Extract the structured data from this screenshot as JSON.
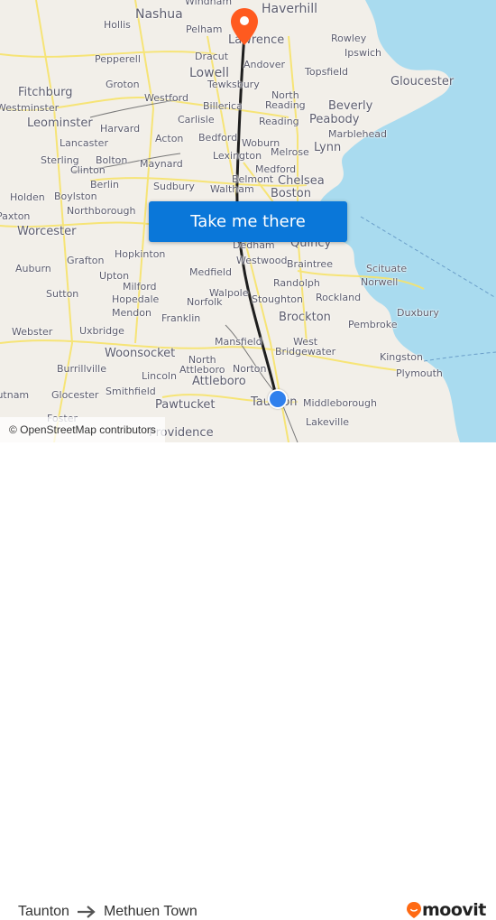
{
  "map": {
    "attribution": "© OpenStreetMap contributors",
    "colors": {
      "land": "#f2efe9",
      "water": "#a9dbef",
      "roads": "#f7e36a",
      "route_line": "#1e1e1e",
      "destination_pin": "#ff5a1f",
      "origin_dot": "#2f80ed"
    },
    "places": [
      {
        "name": "Windham",
        "size": "s"
      },
      {
        "name": "Haverhill",
        "size": "l"
      },
      {
        "name": "Nashua",
        "size": "l"
      },
      {
        "name": "Hollis",
        "size": "s"
      },
      {
        "name": "Pelham",
        "size": "s"
      },
      {
        "name": "Lawrence",
        "size": "m"
      },
      {
        "name": "Rowley",
        "size": "s"
      },
      {
        "name": "Ipswich",
        "size": "s"
      },
      {
        "name": "Pepperell",
        "size": "s"
      },
      {
        "name": "Dracut",
        "size": "s"
      },
      {
        "name": "Andover",
        "size": "s"
      },
      {
        "name": "Topsfield",
        "size": "s"
      },
      {
        "name": "Lowell",
        "size": "l"
      },
      {
        "name": "Tewksbury",
        "size": "s"
      },
      {
        "name": "Gloucester",
        "size": "m"
      },
      {
        "name": "Fitchburg",
        "size": "m"
      },
      {
        "name": "Groton",
        "size": "s"
      },
      {
        "name": "Westminster",
        "size": "s"
      },
      {
        "name": "Westford",
        "size": "s"
      },
      {
        "name": "North Reading",
        "size": "s"
      },
      {
        "name": "Beverly",
        "size": "m"
      },
      {
        "name": "Billerica",
        "size": "s"
      },
      {
        "name": "Leominster",
        "size": "m"
      },
      {
        "name": "Reading",
        "size": "s"
      },
      {
        "name": "Peabody",
        "size": "m"
      },
      {
        "name": "Harvard",
        "size": "s"
      },
      {
        "name": "Carlisle",
        "size": "s"
      },
      {
        "name": "Marblehead",
        "size": "s"
      },
      {
        "name": "Lancaster",
        "size": "s"
      },
      {
        "name": "Acton",
        "size": "s"
      },
      {
        "name": "Bedford",
        "size": "s"
      },
      {
        "name": "Woburn",
        "size": "s"
      },
      {
        "name": "Lynn",
        "size": "m"
      },
      {
        "name": "Melrose",
        "size": "s"
      },
      {
        "name": "Sterling",
        "size": "s"
      },
      {
        "name": "Bolton",
        "size": "s"
      },
      {
        "name": "Lexington",
        "size": "s"
      },
      {
        "name": "Clinton",
        "size": "s"
      },
      {
        "name": "Maynard",
        "size": "s"
      },
      {
        "name": "Medford",
        "size": "s"
      },
      {
        "name": "Berlin",
        "size": "s"
      },
      {
        "name": "Belmont",
        "size": "s"
      },
      {
        "name": "Chelsea",
        "size": "m"
      },
      {
        "name": "Sudbury",
        "size": "s"
      },
      {
        "name": "Waltham",
        "size": "s"
      },
      {
        "name": "Holden",
        "size": "s"
      },
      {
        "name": "Boylston",
        "size": "s"
      },
      {
        "name": "Boston",
        "size": "m"
      },
      {
        "name": "Northborough",
        "size": "s"
      },
      {
        "name": "Paxton",
        "size": "s"
      },
      {
        "name": "Worcester",
        "size": "m"
      },
      {
        "name": "Dedham",
        "size": "s"
      },
      {
        "name": "Quincy",
        "size": "m"
      },
      {
        "name": "Hopkinton",
        "size": "s"
      },
      {
        "name": "Westwood",
        "size": "s"
      },
      {
        "name": "Braintree",
        "size": "s"
      },
      {
        "name": "Grafton",
        "size": "s"
      },
      {
        "name": "Auburn",
        "size": "s"
      },
      {
        "name": "Medfield",
        "size": "s"
      },
      {
        "name": "Scituate",
        "size": "s"
      },
      {
        "name": "Upton",
        "size": "s"
      },
      {
        "name": "Randolph",
        "size": "s"
      },
      {
        "name": "Norwell",
        "size": "s"
      },
      {
        "name": "Milford",
        "size": "s"
      },
      {
        "name": "Walpole",
        "size": "s"
      },
      {
        "name": "Sutton",
        "size": "s"
      },
      {
        "name": "Hopedale",
        "size": "s"
      },
      {
        "name": "Norfolk",
        "size": "s"
      },
      {
        "name": "Stoughton",
        "size": "s"
      },
      {
        "name": "Rockland",
        "size": "s"
      },
      {
        "name": "Mendon",
        "size": "s"
      },
      {
        "name": "Franklin",
        "size": "s"
      },
      {
        "name": "Brockton",
        "size": "m"
      },
      {
        "name": "Pembroke",
        "size": "s"
      },
      {
        "name": "Webster",
        "size": "s"
      },
      {
        "name": "Uxbridge",
        "size": "s"
      },
      {
        "name": "Duxbury",
        "size": "s"
      },
      {
        "name": "Mansfield",
        "size": "s"
      },
      {
        "name": "West Bridgewater",
        "size": "s"
      },
      {
        "name": "Woonsocket",
        "size": "m"
      },
      {
        "name": "North Attleboro",
        "size": "s"
      },
      {
        "name": "Kingston",
        "size": "s"
      },
      {
        "name": "Burrillville",
        "size": "s"
      },
      {
        "name": "Norton",
        "size": "s"
      },
      {
        "name": "Lincoln",
        "size": "s"
      },
      {
        "name": "Plymouth",
        "size": "s"
      },
      {
        "name": "Attleboro",
        "size": "m"
      },
      {
        "name": "Putnam",
        "size": "s"
      },
      {
        "name": "Glocester",
        "size": "s"
      },
      {
        "name": "Smithfield",
        "size": "s"
      },
      {
        "name": "Taunton",
        "size": "m"
      },
      {
        "name": "Middleborough",
        "size": "s"
      },
      {
        "name": "Pawtucket",
        "size": "m"
      },
      {
        "name": "Lakeville",
        "size": "s"
      },
      {
        "name": "Foster",
        "size": "s"
      },
      {
        "name": "Providence",
        "size": "m"
      }
    ]
  },
  "cta": {
    "label": "Take me there"
  },
  "footer": {
    "origin": "Taunton",
    "destination": "Methuen Town",
    "arrow_icon": "arrow-right-icon",
    "brand": "moovit",
    "brand_color": "#ff6a13"
  }
}
